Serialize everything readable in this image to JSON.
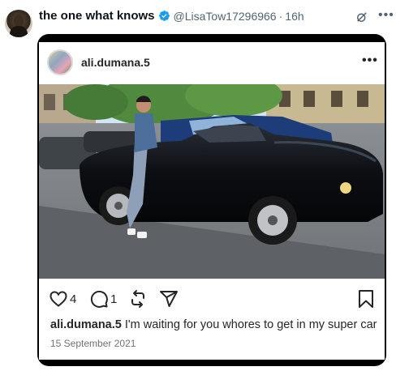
{
  "tweet": {
    "display_name": "the one what knows",
    "handle": "@LisaTow17296966",
    "separator": "·",
    "time": "16h"
  },
  "embed": {
    "username": "ali.dumana.5",
    "likes": "4",
    "comments": "1",
    "caption_user": "ali.dumana.5",
    "caption_text": " I'm waiting for you whores to get in my super car",
    "date": "15 September 2021"
  },
  "icons": {
    "verified": "verified-badge-icon",
    "grok": "grok-icon",
    "more": "more-icon",
    "heart": "heart-icon",
    "comment": "comment-icon",
    "repost": "repost-icon",
    "share": "send-icon",
    "bookmark": "bookmark-icon"
  },
  "colors": {
    "verified_blue": "#1d9bf0",
    "text_primary": "#0f1419",
    "text_secondary": "#536471",
    "frame": "#000000"
  }
}
